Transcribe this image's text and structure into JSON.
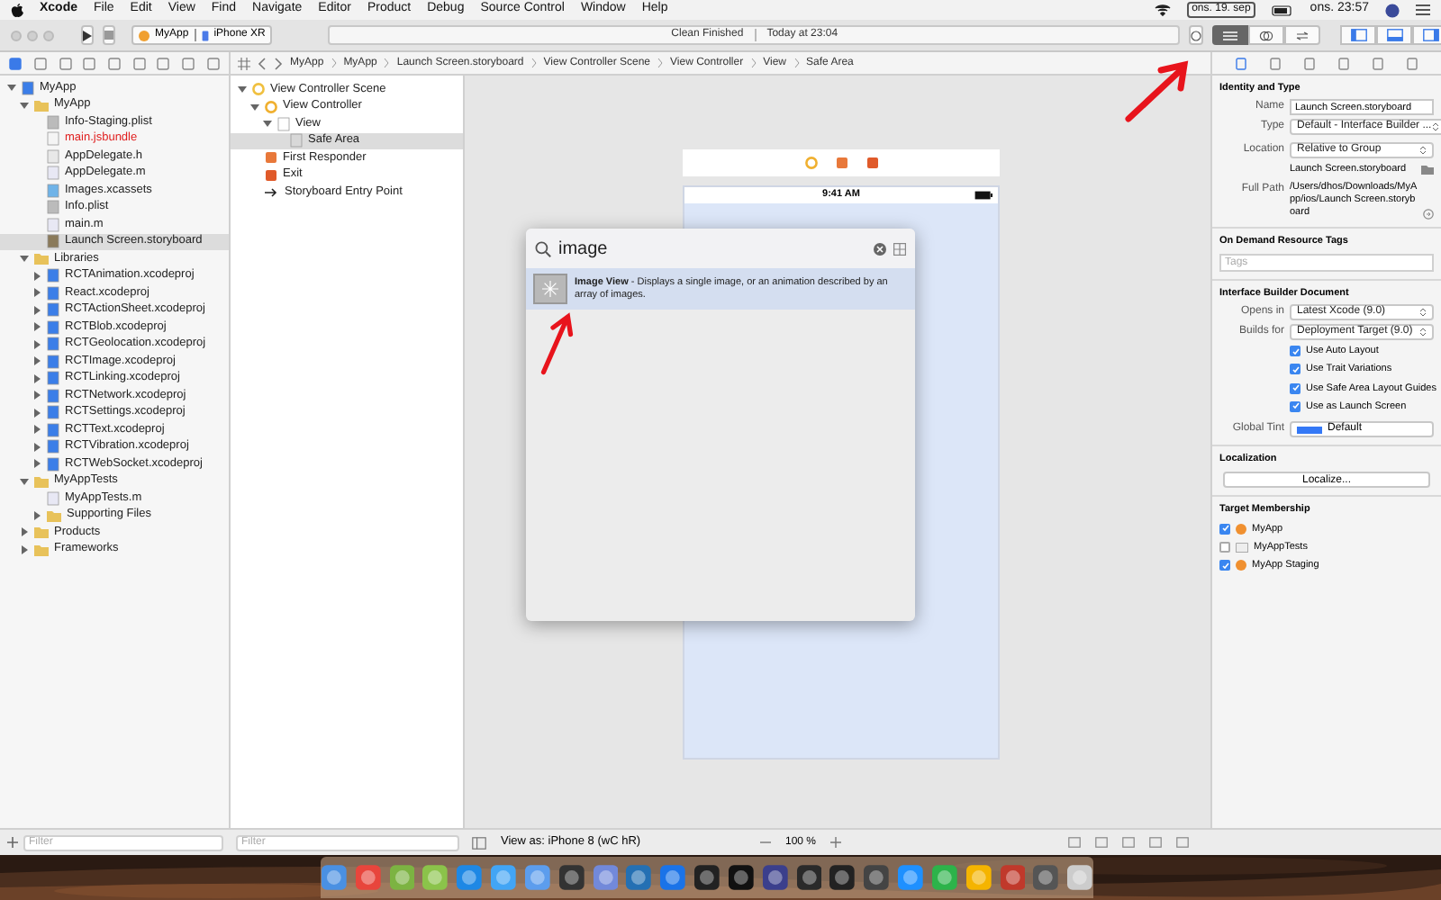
{
  "menu_bar": {
    "items": [
      "Xcode",
      "File",
      "Edit",
      "View",
      "Find",
      "Navigate",
      "Editor",
      "Product",
      "Debug",
      "Source Control",
      "Window",
      "Help"
    ],
    "date": "ons. 19. sep",
    "clock": "ons. 23:57"
  },
  "toolbar": {
    "scheme": "MyApp",
    "device": "iPhone XR",
    "status": "Clean Finished",
    "time": "Today at 23:04"
  },
  "jump_bar": [
    "MyApp",
    "MyApp",
    "Launch Screen.storyboard",
    "View Controller Scene",
    "View Controller",
    "View",
    "Safe Area"
  ],
  "navigator": {
    "tree": [
      {
        "name": "MyApp",
        "kind": "project",
        "expanded": true,
        "selected": false,
        "children": [
          {
            "name": "MyApp",
            "kind": "folder",
            "expanded": true,
            "selected": false,
            "children": [
              {
                "name": "Info-Staging.plist",
                "kind": "plist",
                "selected": false,
                "missing": false
              },
              {
                "name": "main.jsbundle",
                "kind": "file",
                "selected": false,
                "missing": true
              },
              {
                "name": "AppDelegate.h",
                "kind": "header",
                "selected": false,
                "missing": false
              },
              {
                "name": "AppDelegate.m",
                "kind": "source",
                "selected": false,
                "missing": false
              },
              {
                "name": "Images.xcassets",
                "kind": "assets",
                "selected": false,
                "missing": false
              },
              {
                "name": "Info.plist",
                "kind": "plist",
                "selected": false,
                "missing": false
              },
              {
                "name": "main.m",
                "kind": "source",
                "selected": false,
                "missing": false
              },
              {
                "name": "Launch Screen.storyboard",
                "kind": "storyboard",
                "selected": true,
                "missing": false
              }
            ]
          },
          {
            "name": "Libraries",
            "kind": "folder",
            "expanded": true,
            "selected": false,
            "children": [
              {
                "name": "RCTAnimation.xcodeproj",
                "kind": "project",
                "expanded": false,
                "selected": false
              },
              {
                "name": "React.xcodeproj",
                "kind": "project",
                "expanded": false,
                "selected": false
              },
              {
                "name": "RCTActionSheet.xcodeproj",
                "kind": "project",
                "expanded": false,
                "selected": false
              },
              {
                "name": "RCTBlob.xcodeproj",
                "kind": "project",
                "expanded": false,
                "selected": false
              },
              {
                "name": "RCTGeolocation.xcodeproj",
                "kind": "project",
                "expanded": false,
                "selected": false
              },
              {
                "name": "RCTImage.xcodeproj",
                "kind": "project",
                "expanded": false,
                "selected": false
              },
              {
                "name": "RCTLinking.xcodeproj",
                "kind": "project",
                "expanded": false,
                "selected": false
              },
              {
                "name": "RCTNetwork.xcodeproj",
                "kind": "project",
                "expanded": false,
                "selected": false
              },
              {
                "name": "RCTSettings.xcodeproj",
                "kind": "project",
                "expanded": false,
                "selected": false
              },
              {
                "name": "RCTText.xcodeproj",
                "kind": "project",
                "expanded": false,
                "selected": false
              },
              {
                "name": "RCTVibration.xcodeproj",
                "kind": "project",
                "expanded": false,
                "selected": false
              },
              {
                "name": "RCTWebSocket.xcodeproj",
                "kind": "project",
                "expanded": false,
                "selected": false
              }
            ]
          },
          {
            "name": "MyAppTests",
            "kind": "folder",
            "expanded": true,
            "selected": false,
            "children": [
              {
                "name": "MyAppTests.m",
                "kind": "source",
                "selected": false,
                "missing": false
              },
              {
                "name": "Supporting Files",
                "kind": "folder",
                "expanded": false,
                "selected": false
              }
            ]
          },
          {
            "name": "Products",
            "kind": "folder",
            "expanded": false,
            "selected": false
          },
          {
            "name": "Frameworks",
            "kind": "folder",
            "expanded": false,
            "selected": false
          }
        ]
      }
    ],
    "filter": {
      "placeholder": "Filter"
    }
  },
  "outline": {
    "tree": [
      {
        "name": "View Controller Scene",
        "kind": "scene",
        "expanded": true,
        "selected": false,
        "children": [
          {
            "name": "View Controller",
            "kind": "controller",
            "expanded": true,
            "selected": false,
            "children": [
              {
                "name": "View",
                "kind": "view",
                "expanded": true,
                "selected": false,
                "children": [
                  {
                    "name": "Safe Area",
                    "kind": "safearea",
                    "selected": true
                  }
                ]
              }
            ]
          },
          {
            "name": "First Responder",
            "kind": "responder",
            "selected": false
          },
          {
            "name": "Exit",
            "kind": "exit",
            "selected": false
          },
          {
            "name": "Storyboard Entry Point",
            "kind": "entry",
            "selected": false
          }
        ]
      }
    ],
    "filter": {
      "placeholder": "Filter"
    }
  },
  "canvas": {
    "status_time": "9:41 AM",
    "view_as": "View as: iPhone 8 (wC hR)",
    "zoom": "100 %"
  },
  "library": {
    "query": "image",
    "results": [
      {
        "text": "**Image View** - Displays a single image, or an animation described by an array of images.",
        "selected": true
      }
    ]
  },
  "inspector": {
    "identity": {
      "title": "Identity and Type",
      "name_label": "Name",
      "name": "Launch Screen.storyboard",
      "type_label": "Type",
      "type": "Default - Interface Builder ...",
      "location_label": "Location",
      "location": "Relative to Group",
      "file": "Launch Screen.storyboard",
      "full_path_label": "Full Path",
      "full_path": "/Users/dhos/Downloads/MyApp/ios/Launch Screen.storyboard"
    },
    "tags": {
      "title": "On Demand Resource Tags",
      "placeholder": "Tags"
    },
    "ib": {
      "title": "Interface Builder Document",
      "opens_label": "Opens in",
      "opens": "Latest Xcode (9.0)",
      "builds_label": "Builds for",
      "builds": "Deployment Target (9.0)",
      "options": [
        {
          "label": "Use Auto Layout",
          "checked": true
        },
        {
          "label": "Use Trait Variations",
          "checked": true
        },
        {
          "label": "Use Safe Area Layout Guides",
          "checked": true
        },
        {
          "label": "Use as Launch Screen",
          "checked": true
        }
      ],
      "tint_label": "Global Tint",
      "tint": "Default"
    },
    "localization": {
      "title": "Localization",
      "button": "Localize..."
    },
    "membership": {
      "title": "Target Membership",
      "targets": [
        {
          "name": "MyApp",
          "checked": true,
          "kind": "app"
        },
        {
          "name": "MyAppTests",
          "checked": false,
          "kind": "tests"
        },
        {
          "name": "MyApp Staging",
          "checked": true,
          "kind": "app"
        }
      ]
    }
  }
}
